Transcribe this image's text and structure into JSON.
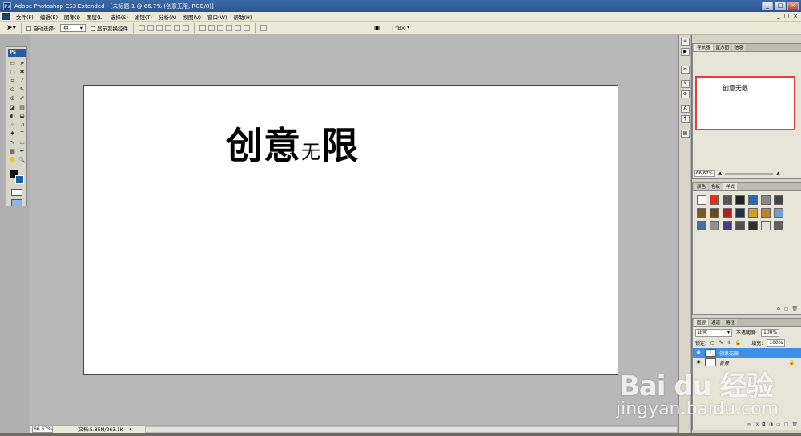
{
  "window": {
    "title": "Adobe Photoshop CS3 Extended - [未标题-1 @ 66.7% (创意无限, RGB/8)]",
    "logo": "Ps",
    "min_label": "_",
    "max_label": "□",
    "close_label": "×"
  },
  "menu": {
    "items": [
      "文件(F)",
      "编辑(E)",
      "图像(I)",
      "图层(L)",
      "选择(S)",
      "滤镜(T)",
      "分析(A)",
      "视图(V)",
      "窗口(W)",
      "帮助(H)"
    ],
    "doc_min": "_",
    "doc_restore": "□",
    "doc_close": "×"
  },
  "options": {
    "auto_select_label": "自动选择:",
    "auto_select_value": "组",
    "show_transform_label": "显示变换控件",
    "workspace_label": "工作区"
  },
  "toolbox": {
    "logo": "Ps",
    "tools": [
      "▭",
      "➤",
      "◌",
      "✱",
      "⌗",
      "⁄",
      "⊙",
      "✎",
      "⊕",
      "✐",
      "◪",
      "▤",
      "◐",
      "◒",
      "♨",
      "⊿",
      "♦",
      "T",
      "↖",
      "▭",
      "▦",
      "✒",
      "✋",
      "🔍"
    ]
  },
  "canvas": {
    "text_main_a": "创意",
    "text_small": "无",
    "text_main_b": "限"
  },
  "status": {
    "zoom": "66.67%",
    "doc_info": "文档:5.85M/263.1K",
    "arrow": "▸"
  },
  "panels": {
    "navigator": {
      "tabs": [
        "导航器",
        "直方图",
        "信息"
      ],
      "preview_text": "创意无限",
      "zoom": "66.67%"
    },
    "styles": {
      "tabs": [
        "颜色",
        "色板",
        "样式"
      ],
      "swatch_colors": [
        "#ffffff",
        "#e03020",
        "#555555",
        "#222222",
        "#2a6ab0",
        "#888888",
        "#444444",
        "#7a5a20",
        "#6a4a18",
        "#b02020",
        "#203040",
        "#d0a020",
        "#c08030",
        "#70a0d0",
        "#4070a0",
        "#909090",
        "#4a3a8a",
        "#505050",
        "#303030",
        "#e0e0e0",
        "#606060"
      ]
    },
    "layers": {
      "tabs": [
        "图层",
        "通道",
        "路径"
      ],
      "blend_mode": "正常",
      "opacity_label": "不透明度:",
      "opacity_value": "100%",
      "lock_label": "锁定:",
      "fill_label": "填充:",
      "fill_value": "100%",
      "items": [
        {
          "name": "创意无限",
          "thumb": "T"
        },
        {
          "name": "背景",
          "thumb": ""
        }
      ]
    }
  },
  "watermark": {
    "line1": "Bai du 经验",
    "line2": "jingyan.baidu.com"
  }
}
